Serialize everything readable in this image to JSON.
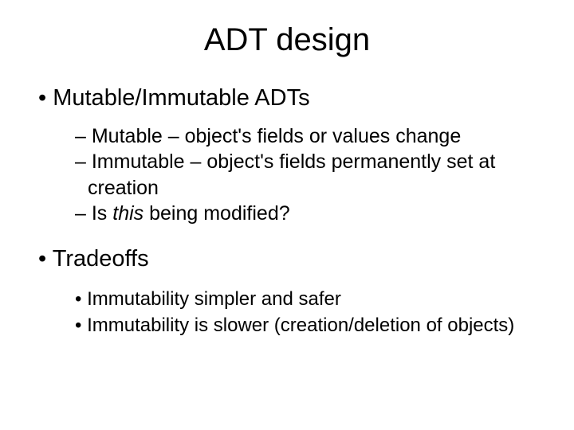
{
  "title": "ADT design",
  "section1": {
    "heading": "Mutable/Immutable ADTs",
    "items": [
      "Mutable – object's fields or values change",
      "Immutable – object's fields permanently set at creation"
    ],
    "item3_prefix": "Is ",
    "item3_italic": "this",
    "item3_suffix": " being modified?"
  },
  "section2": {
    "heading": "Tradeoffs",
    "items": [
      "Immutability simpler and safer",
      "Immutability is slower (creation/deletion of objects)"
    ]
  }
}
